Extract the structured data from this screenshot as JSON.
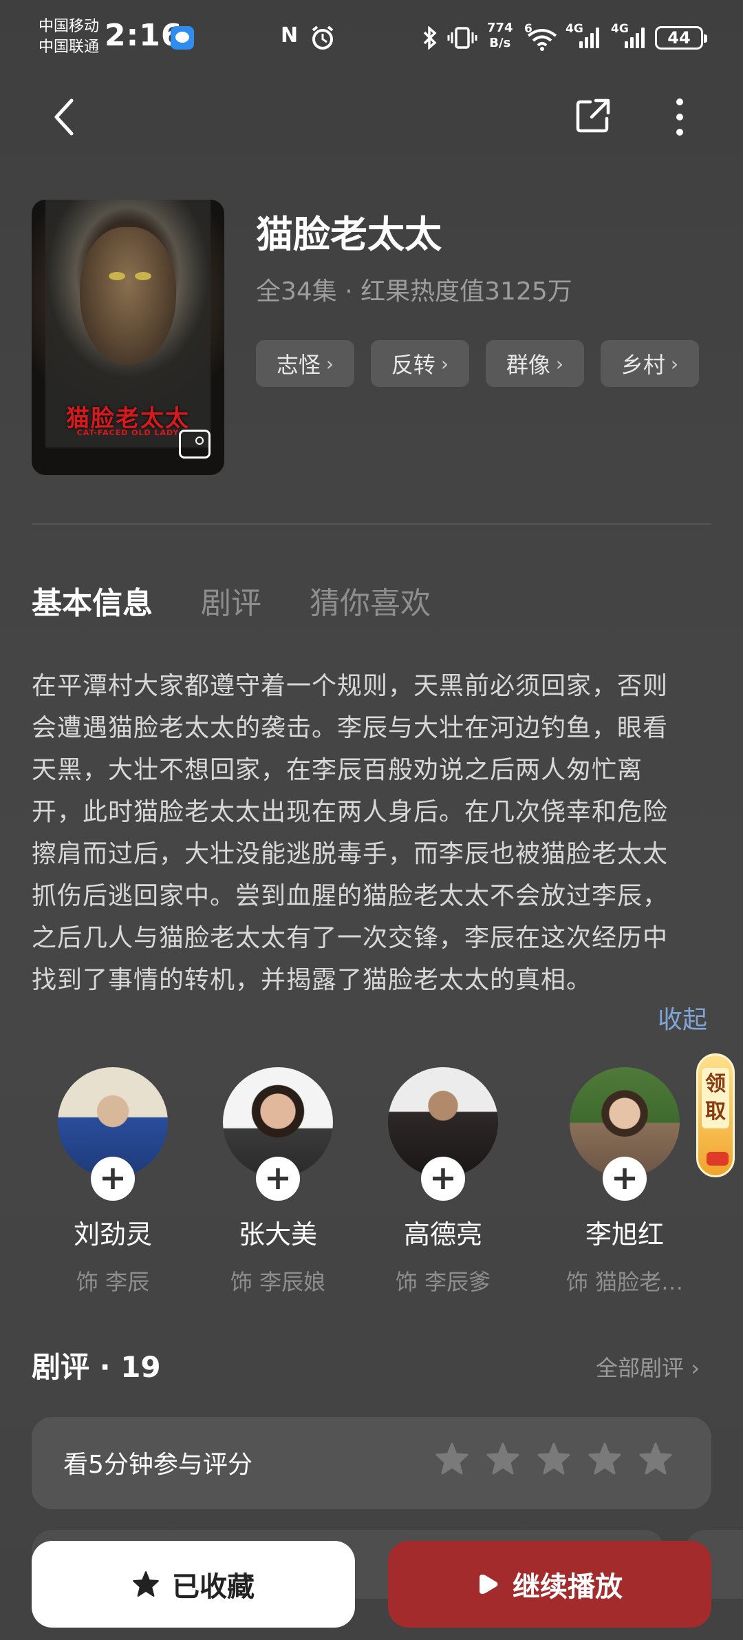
{
  "status_bar": {
    "carrier_1": "中国移动",
    "carrier_2": "中国联通",
    "time": "2:16",
    "net_speed_value": "774",
    "net_speed_unit": "B/s",
    "wifi_label": "6",
    "sim1_label": "4G",
    "sim2_label": "4G",
    "battery": "44"
  },
  "drama": {
    "title": "猫脸老太太",
    "meta": "全34集 · 红果热度值3125万",
    "poster_title": "猫脸老太太",
    "poster_subtitle": "CAT-FACED OLD LADY",
    "tags": [
      {
        "label": "志怪"
      },
      {
        "label": "反转"
      },
      {
        "label": "群像"
      },
      {
        "label": "乡村"
      }
    ]
  },
  "tabs": [
    {
      "label": "基本信息",
      "active": true
    },
    {
      "label": "剧评",
      "active": false
    },
    {
      "label": "猜你喜欢",
      "active": false
    }
  ],
  "synopsis": "在平潭村大家都遵守着一个规则，天黑前必须回家，否则会遭遇猫脸老太太的袭击。李辰与大壮在河边钓鱼，眼看天黑，大壮不想回家，在李辰百般劝说之后两人匆忙离开，此时猫脸老太太出现在两人身后。在几次侥幸和危险擦肩而过后，大壮没能逃脱毒手，而李辰也被猫脸老太太抓伤后逃回家中。尝到血腥的猫脸老太太不会放过李辰，之后几人与猫脸老太太有了一次交锋，李辰在这次经历中找到了事情的转机，并揭露了猫脸老太太的真相。",
  "collapse_label": "收起",
  "claim_badge": "领取",
  "cast": [
    {
      "name": "刘劲灵",
      "role": "饰 李辰",
      "plus": "+"
    },
    {
      "name": "张大美",
      "role": "饰 李辰娘",
      "plus": "+"
    },
    {
      "name": "高德亮",
      "role": "饰 李辰爹",
      "plus": "+"
    },
    {
      "name": "李旭红",
      "role": "饰 猫脸老…",
      "plus": "+"
    }
  ],
  "reviews": {
    "title": "剧评 · 19",
    "all_label": "全部剧评",
    "all_chevron": "›",
    "rate_prompt": "看5分钟参与评分",
    "stars": 5,
    "star_icon": "star-icon"
  },
  "bottom": {
    "favorite_label": "已收藏",
    "play_label": "继续播放"
  },
  "colors": {
    "background": "#434343",
    "accent_red": "#a32b2c",
    "link_blue": "#7fa6d6",
    "tag_bg": "#595959"
  }
}
